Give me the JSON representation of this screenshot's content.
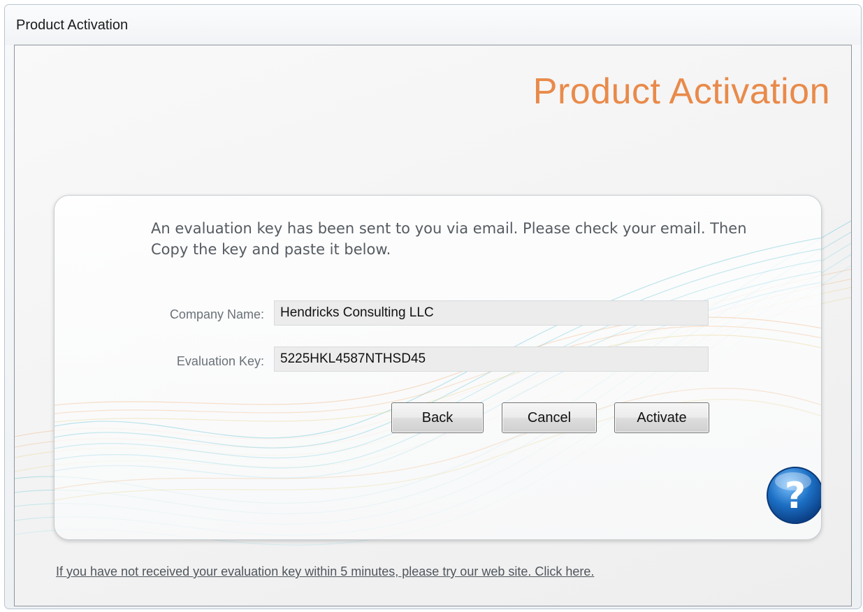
{
  "window": {
    "title": "Product Activation"
  },
  "header": {
    "title": "Product Activation"
  },
  "panel": {
    "message": "An evaluation key has been sent to you via email. Please check your email. Then Copy the key and paste it below.",
    "company_label": "Company Name:",
    "company_value": "Hendricks Consulting LLC",
    "key_label": "Evaluation Key:",
    "key_value": "5225HKL4587NTHSD45",
    "buttons": {
      "back": "Back",
      "cancel": "Cancel",
      "activate": "Activate"
    },
    "help_icon": "question-mark-icon"
  },
  "footer": {
    "link_text": "If you have not received your evaluation key within 5 minutes, please try our web site. Click here."
  },
  "colors": {
    "header_title": "#e98a4a",
    "help_icon": "#1c6fc4",
    "wave_blue": "#6cc7d8",
    "wave_orange": "#f0b27a",
    "wave_yellow": "#e9d48b"
  }
}
